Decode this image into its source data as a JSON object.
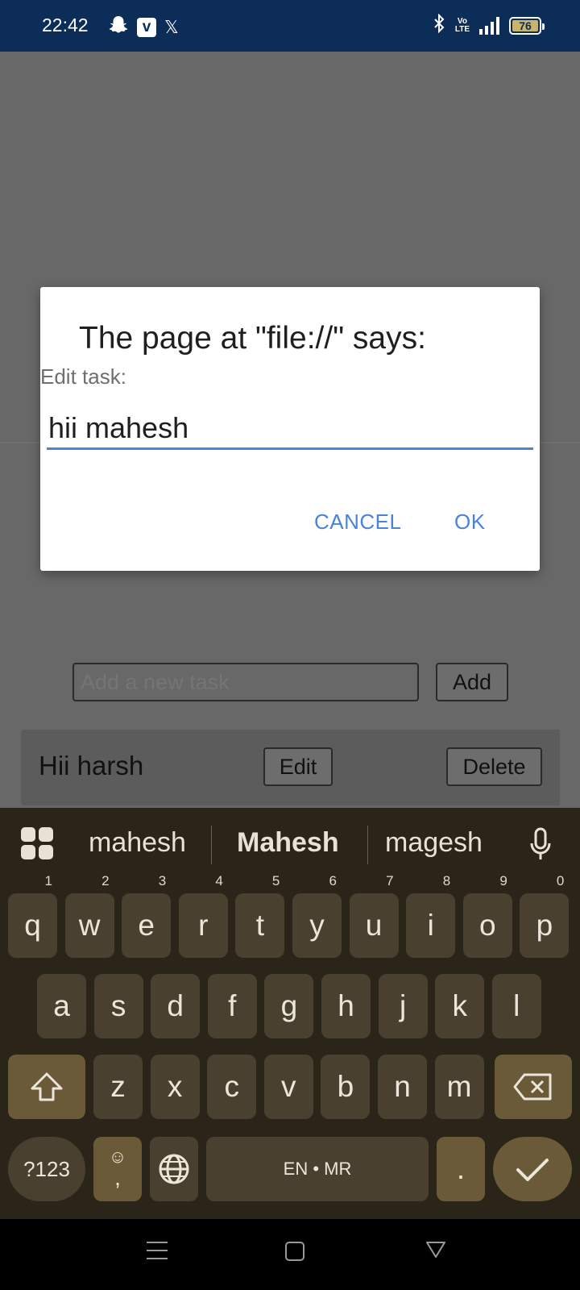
{
  "status_bar": {
    "time": "22:42",
    "left_icons": [
      "snapchat-icon",
      "v-app-icon",
      "x-icon"
    ],
    "x_glyph": "𝕏",
    "v_glyph": "v",
    "volte_top": "Vo",
    "volte_bottom": "LTE",
    "battery": "76"
  },
  "page": {
    "new_task_placeholder": "Add a new task",
    "add_label": "Add",
    "tasks": [
      {
        "text": "Hii harsh",
        "edit_label": "Edit",
        "delete_label": "Delete"
      }
    ]
  },
  "dialog": {
    "title": "The page at \"file://\" says:",
    "message": "Edit task:",
    "input_value": "hii mahesh",
    "cancel_label": "CANCEL",
    "ok_label": "OK"
  },
  "keyboard": {
    "suggestions": [
      "mahesh",
      "Mahesh",
      "magesh"
    ],
    "row1": [
      {
        "k": "q",
        "n": "1"
      },
      {
        "k": "w",
        "n": "2"
      },
      {
        "k": "e",
        "n": "3"
      },
      {
        "k": "r",
        "n": "4"
      },
      {
        "k": "t",
        "n": "5"
      },
      {
        "k": "y",
        "n": "6"
      },
      {
        "k": "u",
        "n": "7"
      },
      {
        "k": "i",
        "n": "8"
      },
      {
        "k": "o",
        "n": "9"
      },
      {
        "k": "p",
        "n": "0"
      }
    ],
    "row2": [
      "a",
      "s",
      "d",
      "f",
      "g",
      "h",
      "j",
      "k",
      "l"
    ],
    "row3": [
      "z",
      "x",
      "c",
      "v",
      "b",
      "n",
      "m"
    ],
    "symbols_label": "?123",
    "emoji_comma": ",",
    "space_label": "EN • MR",
    "period_label": "."
  },
  "colors": {
    "accent_blue": "#4a84d6",
    "status_bar": "#0b2d57",
    "keyboard_bg": "#2b2418",
    "key_bg": "#4a4030",
    "fn_key_bg": "#6a5a38"
  }
}
